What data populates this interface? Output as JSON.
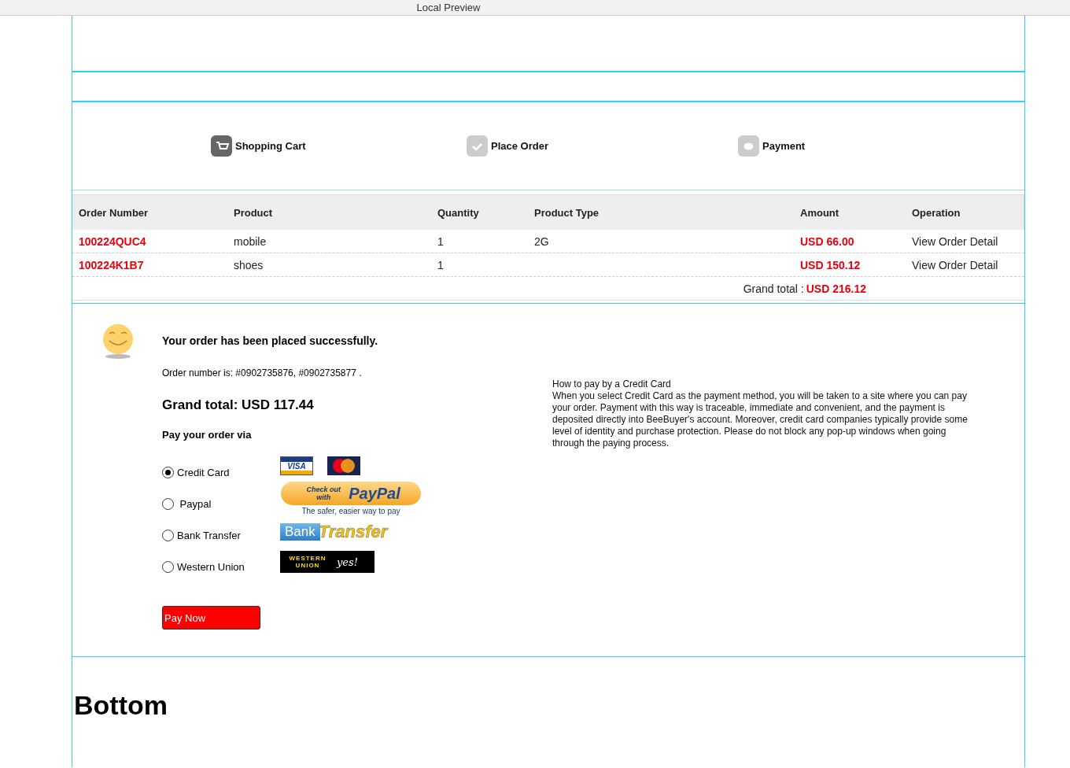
{
  "window": {
    "title": "Local Preview"
  },
  "steps": [
    {
      "label": "Shopping Cart",
      "kind": "cart",
      "active": true
    },
    {
      "label": "Place  Order",
      "kind": "check",
      "active": false
    },
    {
      "label": "Payment",
      "kind": "dollar",
      "active": false
    }
  ],
  "table": {
    "columns": [
      "Order Number",
      "Product",
      "Quantity",
      "Product Type",
      "Amount",
      "Operation"
    ],
    "rows": [
      {
        "order_number": "100224QUC4",
        "product": "mobile",
        "quantity": "1",
        "product_type": "2G",
        "amount": "USD 66.00",
        "operation": "View Order Detail"
      },
      {
        "order_number": "100224K1B7",
        "product": "shoes",
        "quantity": "1",
        "amount": "USD 150.12",
        "operation": "View Order Detail"
      }
    ],
    "grand_total_label": "Grand total :",
    "grand_total": "USD 216.12"
  },
  "confirmation": {
    "headline": "Your order has been placed successfully.",
    "order_numbers": "Order number is: #0902735876, #0902735877 .",
    "grand_total": "Grand total: USD 117.44",
    "pay_via": "Pay your order via"
  },
  "payment_methods": [
    {
      "label": "Credit Card",
      "selected": true,
      "kind": "cards",
      "logo_text": [
        "VISA"
      ]
    },
    {
      "label": " Paypal",
      "selected": false,
      "kind": "paypal",
      "logo_text": [
        "Check out with",
        "PayPal",
        "The safer, easier way to pay"
      ]
    },
    {
      "label": "Bank Transfer",
      "selected": false,
      "kind": "bank",
      "logo_text": [
        "Bank",
        "Transfer"
      ]
    },
    {
      "label": "Western Union",
      "selected": false,
      "kind": "wu",
      "logo_text": [
        "WESTERN UNION",
        "yes!"
      ]
    }
  ],
  "pay_button": "Pay Now",
  "help": {
    "title": "How to pay by a Credit Card",
    "body": "When you select Credit Card as the payment method, you will be taken to a site where you can pay your order. Payment with this way is traceable, immediate and convenient, and the payment is deposited directly into BeeBuyer's account. Moreover, credit card companies typically provide some level of identity and purchase protection. Please do not block any pop-up windows when going through the paying process."
  },
  "footer": {
    "title": "Bottom"
  }
}
